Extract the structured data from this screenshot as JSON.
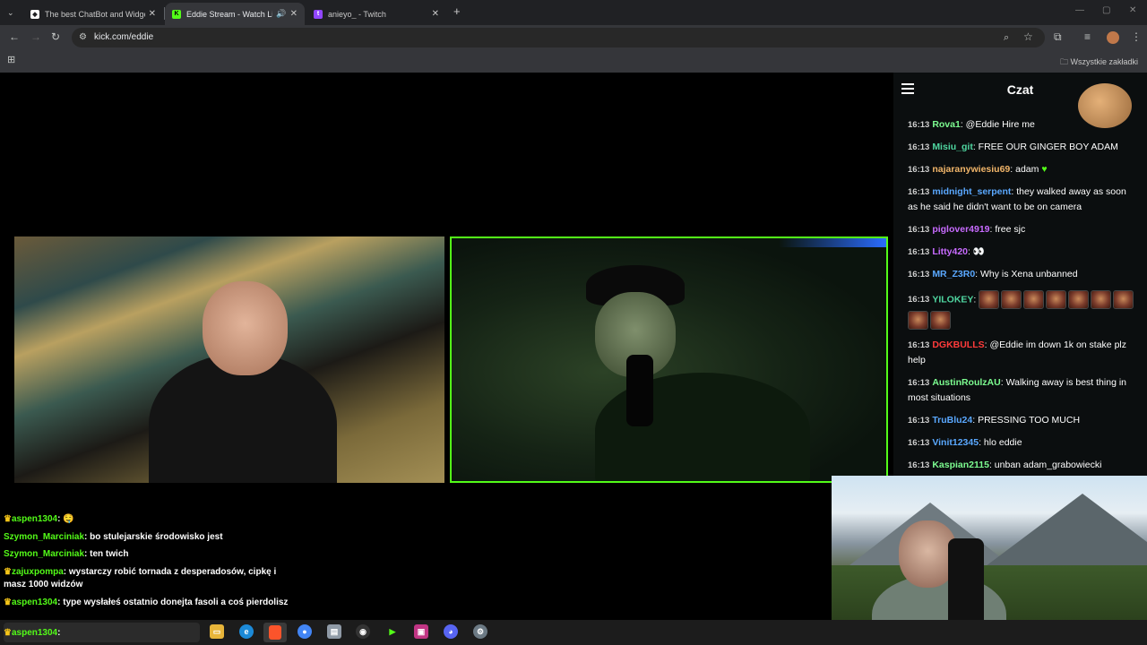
{
  "browser": {
    "tabs": [
      {
        "title": "The best ChatBot and Widgets",
        "favicon": "streamelements-icon",
        "active": false
      },
      {
        "title": "Eddie Stream - Watch Live o",
        "favicon": "kick-icon",
        "active": true
      },
      {
        "title": "anieyo_ - Twitch",
        "favicon": "twitch-icon",
        "active": false
      }
    ],
    "url": "kick.com/eddie",
    "bookmarks_label": "Wszystkie zakładki"
  },
  "chat_panel": {
    "title": "Czat",
    "messages": [
      {
        "time": "16:13",
        "user": "Rova1",
        "color": "#7cfc90",
        "text": "@Eddie Hire me"
      },
      {
        "time": "16:13",
        "user": "Misiu_git",
        "color": "#4fd6a0",
        "text": "FREE OUR GINGER BOY ADAM"
      },
      {
        "time": "16:13",
        "user": "najaranywiesiu69",
        "color": "#f2b66a",
        "text": "adam"
      },
      {
        "time": "16:13",
        "user": "midnight_serpent",
        "color": "#5aa8ff",
        "text": "they walked away as soon as he said he didn't want to be on camera"
      },
      {
        "time": "16:13",
        "user": "piglover4919",
        "color": "#c86bff",
        "text": "free sjc"
      },
      {
        "time": "16:13",
        "user": "Litty420",
        "color": "#c86bff",
        "text": "👀"
      },
      {
        "time": "16:13",
        "user": "MR_Z3R0",
        "color": "#5aa8ff",
        "text": "Why is Xena unbanned"
      },
      {
        "time": "16:13",
        "user": "YILOKEY",
        "color": "#4fd6a0",
        "text": ""
      },
      {
        "time": "16:13",
        "user": "DGKBULLS",
        "color": "#ff3b3b",
        "text": "@Eddie im down 1k on stake plz help"
      },
      {
        "time": "16:13",
        "user": "AustinRoulzAU",
        "color": "#7cfc90",
        "text": "Walking away is best thing in most situations"
      },
      {
        "time": "16:13",
        "user": "TruBlu24",
        "color": "#5aa8ff",
        "text": "PRESSING TOO MUCH"
      },
      {
        "time": "16:13",
        "user": "Vinit12345",
        "color": "#5aa8ff",
        "text": "hlo eddie"
      },
      {
        "time": "16:13",
        "user": "Kaspian2115",
        "color": "#7cfc90",
        "text": "unban adam_grabowiecki"
      }
    ]
  },
  "overlay_chat": [
    {
      "user": "aspen1304",
      "text": "🤤",
      "crown": true
    },
    {
      "user": "Szymon_Marciniak",
      "text": "bo stulejarskie środowisko jest",
      "crown": false
    },
    {
      "user": "Szymon_Marciniak",
      "text": "ten twich",
      "crown": false
    },
    {
      "user": "zajuxpompa",
      "text": "wystarczy robić tornada z desperadosów, cipkę i masz 1000 widzów",
      "crown": true
    },
    {
      "user": "aspen1304",
      "text": "type wysłałeś ostatnio donejta fasoli a coś pierdolisz",
      "crown": true
    }
  ],
  "bottom_overlay": {
    "user": "aspen1304"
  },
  "colors": {
    "kick_green": "#53fc18",
    "chat_bg": "#0b0e0f"
  }
}
